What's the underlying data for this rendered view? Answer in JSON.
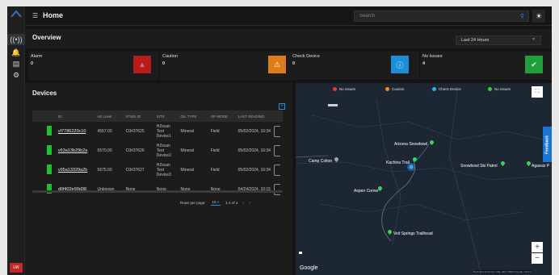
{
  "header": {
    "title": "Home",
    "search_placeholder": "Search"
  },
  "overview": {
    "title": "Overview",
    "time_range": "Last 24 Hours"
  },
  "status_cards": [
    {
      "label": "Alarm",
      "count": "0",
      "color": "#b71c1c",
      "icon": "alarm-icon"
    },
    {
      "label": "Caution",
      "count": "0",
      "color": "#e07b1a",
      "icon": "warning-icon"
    },
    {
      "label": "Check Device",
      "count": "0",
      "color": "#1a8fd6",
      "icon": "info-icon"
    },
    {
      "label": "No Issues",
      "count": "4",
      "color": "#1f9e3a",
      "icon": "check-circle-icon"
    }
  ],
  "devices": {
    "title": "Devices",
    "columns": [
      "ID",
      "H2 Level",
      "STMS ID",
      "SITE",
      "OIL TYPE",
      "OP MODE",
      "LAST READING"
    ],
    "rows": [
      {
        "id": "vf7786220c10",
        "h2": "4557.00",
        "stms": "C0#37625",
        "site": "H2scan Test Device1",
        "oil": "Mineral",
        "mode": "Field",
        "last": "05/02/2024, 16:34"
      },
      {
        "id": "v63a13b29b2a",
        "h2": "5570.00",
        "stms": "C0#37626",
        "site": "H2scan Test Device2",
        "oil": "Mineral",
        "mode": "Field",
        "last": "05/02/2024, 16:34"
      },
      {
        "id": "v95a13329a2b",
        "h2": "5675.00",
        "stms": "C0#37627",
        "site": "H2scan Test Device3",
        "oil": "Mineral",
        "mode": "Field",
        "last": "05/02/2024, 16:34"
      },
      {
        "id": "d0f402e99d38",
        "h2": "Unknown",
        "stms": "None",
        "site": "None",
        "oil": "None",
        "mode": "None",
        "last": "04/24/2024, 10:15"
      }
    ],
    "rows_per_page_label": "Rows per page:",
    "rows_per_page": "10",
    "page_range": "1-4 of 4"
  },
  "map": {
    "legend": [
      {
        "label": "No Issues",
        "color": "#e53935"
      },
      {
        "label": "Caution",
        "color": "#fb8c00"
      },
      {
        "label": "Check Device",
        "color": "#29b6f6"
      },
      {
        "label": "No Issues",
        "color": "#22e022"
      }
    ],
    "places": [
      {
        "name": "Arizona Snowbowl",
        "kind": "green"
      },
      {
        "name": "Camp Colton",
        "kind": "gray"
      },
      {
        "name": "Kachina Trail",
        "kind": "green"
      },
      {
        "name": "Snowbowl Ski Patrol",
        "kind": "green"
      },
      {
        "name": "Agassiz P",
        "kind": "green"
      },
      {
        "name": "Aspen Corner",
        "kind": "green"
      },
      {
        "name": "Veit Springs Trailhead",
        "kind": "green"
      }
    ],
    "google_label": "Google",
    "footer": "Keyboard shortcuts  |  Map data ©2024 Google  |  Terms"
  },
  "user": {
    "initials": "LW"
  },
  "feedback_label": "Feedback"
}
